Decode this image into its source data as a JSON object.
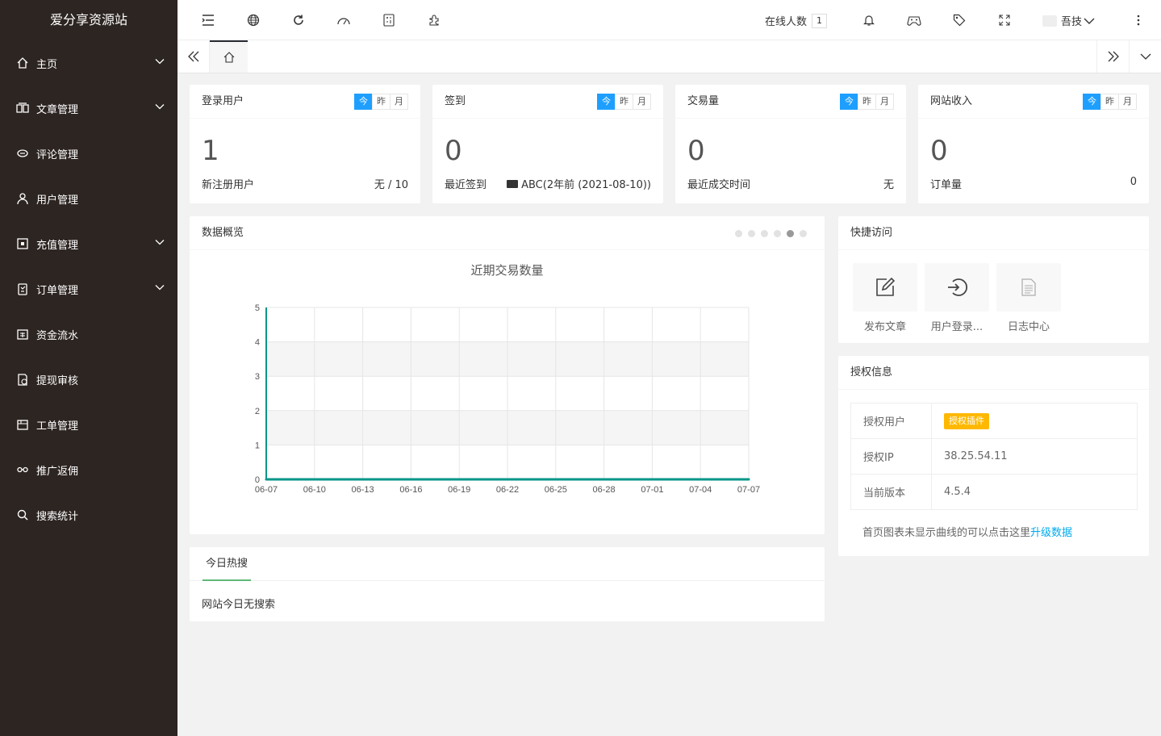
{
  "sidebar": {
    "logo": "爱分享资源站",
    "items": [
      {
        "label": "主页",
        "icon": "home-icon",
        "has_children": true
      },
      {
        "label": "文章管理",
        "icon": "book-icon",
        "has_children": true
      },
      {
        "label": "评论管理",
        "icon": "comment-icon",
        "has_children": false
      },
      {
        "label": "用户管理",
        "icon": "user-icon",
        "has_children": false
      },
      {
        "label": "充值管理",
        "icon": "recharge-icon",
        "has_children": true
      },
      {
        "label": "订单管理",
        "icon": "order-icon",
        "has_children": true
      },
      {
        "label": "资金流水",
        "icon": "money-flow-icon",
        "has_children": false
      },
      {
        "label": "提现审核",
        "icon": "withdraw-icon",
        "has_children": false
      },
      {
        "label": "工单管理",
        "icon": "ticket-icon",
        "has_children": false
      },
      {
        "label": "推广返佣",
        "icon": "link-icon",
        "has_children": false
      },
      {
        "label": "搜索统计",
        "icon": "search-icon",
        "has_children": false
      }
    ]
  },
  "header": {
    "online_label": "在线人数",
    "online_count": "1",
    "username": "吾技"
  },
  "stats": [
    {
      "title": "登录用户",
      "value": "1",
      "foot_label": "新注册用户",
      "foot_value": "无 / 10"
    },
    {
      "title": "签到",
      "value": "0",
      "foot_label": "最近签到",
      "foot_value": "ABC(2年前 (2021-08-10))"
    },
    {
      "title": "交易量",
      "value": "0",
      "foot_label": "最近成交时间",
      "foot_value": "无"
    },
    {
      "title": "网站收入",
      "value": "0",
      "foot_label": "订单量",
      "foot_value": "0"
    }
  ],
  "period_tabs": {
    "today": "今",
    "yesterday": "昨",
    "month": "月"
  },
  "overview": {
    "title": "数据概览"
  },
  "chart_data": {
    "type": "line",
    "title": "近期交易数量",
    "x": [
      "06-07",
      "06-10",
      "06-13",
      "06-16",
      "06-19",
      "06-22",
      "06-25",
      "06-28",
      "07-01",
      "07-04",
      "07-07"
    ],
    "series": [
      {
        "values": [
          0,
          0,
          0,
          0,
          0,
          0,
          0,
          0,
          0,
          0,
          0
        ]
      }
    ],
    "ylim": [
      0,
      5
    ],
    "yticks": [
      0,
      1,
      2,
      3,
      4,
      5
    ],
    "grid": true,
    "color": "#009688"
  },
  "quick_access": {
    "title": "快捷访问",
    "items": [
      {
        "label": "发布文章",
        "icon": "edit-icon"
      },
      {
        "label": "用户登录...",
        "icon": "login-icon"
      },
      {
        "label": "日志中心",
        "icon": "log-icon"
      }
    ]
  },
  "auth": {
    "title": "授权信息",
    "rows": [
      {
        "key": "授权用户",
        "value": "授权插件"
      },
      {
        "key": "授权IP",
        "value": "38.25.54.11"
      },
      {
        "key": "当前版本",
        "value": "4.5.4"
      }
    ],
    "note": "首页图表未显示曲线的可以点击这里",
    "note_link": "升级数据"
  },
  "hot": {
    "tab": "今日热搜",
    "empty": "网站今日无搜索"
  }
}
